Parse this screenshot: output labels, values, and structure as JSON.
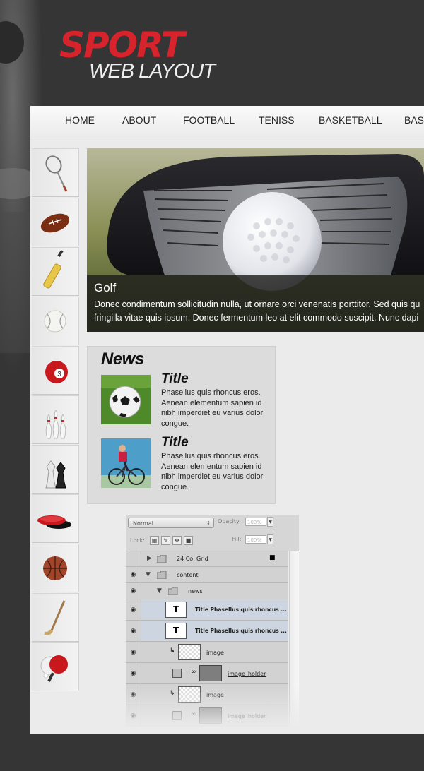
{
  "logo": {
    "title": "SPORT",
    "subtitle": "WEB LAYOUT"
  },
  "nav": {
    "items": [
      "HOME",
      "ABOUT",
      "FOOTBALL",
      "TENISS",
      "BASKETBALL",
      "BASK"
    ]
  },
  "sports_icons": [
    "badminton-racket-icon",
    "american-football-icon",
    "cricket-bat-icon",
    "baseball-icon",
    "billiard-ball-icon",
    "bowling-pins-icon",
    "chess-pieces-icon",
    "frisbee-icon",
    "basketball-icon",
    "hockey-stick-icon",
    "ping-pong-icon"
  ],
  "billiard_number": "3",
  "hero": {
    "title": "Golf",
    "line1": "Donec condimentum sollicitudin nulla, ut ornare orci venenatis porttitor. Sed quis qu",
    "line2": "fringilla vitae quis ipsum. Donec fermentum leo at elit commodo suscipit. Nunc dapi"
  },
  "news": {
    "heading": "News",
    "items": [
      {
        "title": "Title",
        "text": "Phasellus quis rhoncus eros. Aenean elementum sapien id nibh imperdiet eu varius dolor congue."
      },
      {
        "title": "Title",
        "text": "Phasellus quis rhoncus eros. Aenean elementum sapien id nibh imperdiet eu varius dolor congue."
      }
    ]
  },
  "layers_panel": {
    "blend_mode": "Normal",
    "opacity_label": "Opacity:",
    "opacity_value": "100%",
    "lock_label": "Lock:",
    "fill_label": "Fill:",
    "fill_value": "100%",
    "layers": [
      {
        "name": "24 Col Grid",
        "visible": false
      },
      {
        "name": "content",
        "visible": true
      },
      {
        "name": "news",
        "visible": true
      },
      {
        "name": "Title Phasellus quis rhoncus ...",
        "visible": true,
        "type_glyph": "T"
      },
      {
        "name": "Title Phasellus quis rhoncus ...",
        "visible": true,
        "type_glyph": "T"
      },
      {
        "name": "image",
        "visible": true
      },
      {
        "name": "image_holder",
        "visible": true
      },
      {
        "name": "image",
        "visible": true
      },
      {
        "name": "image_holder",
        "visible": true
      }
    ]
  },
  "colors": {
    "brand_red": "#d7232b",
    "background": "#353535",
    "page": "#ebebeb"
  }
}
